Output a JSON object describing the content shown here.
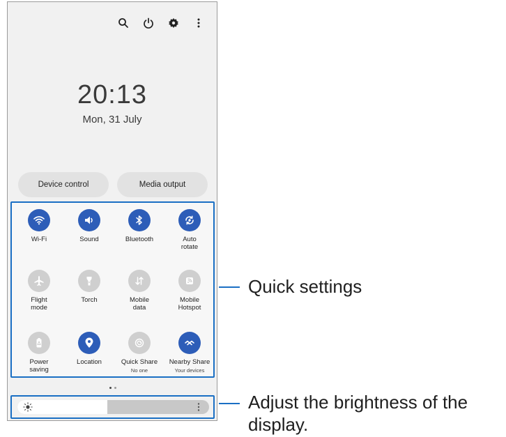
{
  "clock": {
    "time": "20:13",
    "date": "Mon, 31 July"
  },
  "topbar": {
    "icons": [
      "search-icon",
      "power-icon",
      "gear-icon",
      "more-vertical-icon"
    ]
  },
  "pills": {
    "device_control": "Device control",
    "media_output": "Media output"
  },
  "tiles": [
    {
      "label": "Wi-Fi",
      "icon": "wifi-icon",
      "state": "on"
    },
    {
      "label": "Sound",
      "icon": "sound-icon",
      "state": "on"
    },
    {
      "label": "Bluetooth",
      "icon": "bluetooth-icon",
      "state": "on"
    },
    {
      "label": "Auto rotate",
      "icon": "auto-rotate-icon",
      "state": "on"
    },
    {
      "label": "Flight mode",
      "icon": "airplane-icon",
      "state": "off"
    },
    {
      "label": "Torch",
      "icon": "torch-icon",
      "state": "off"
    },
    {
      "label": "Mobile data",
      "icon": "mobile-data-icon",
      "state": "off"
    },
    {
      "label": "Mobile Hotspot",
      "icon": "hotspot-icon",
      "state": "off"
    },
    {
      "label": "Power saving",
      "icon": "battery-icon",
      "state": "off"
    },
    {
      "label": "Location",
      "icon": "location-pin-icon",
      "state": "on"
    },
    {
      "label": "Quick Share",
      "sublabel": "No one",
      "icon": "quick-share-icon",
      "state": "off"
    },
    {
      "label": "Nearby Share",
      "sublabel": "Your devices",
      "icon": "nearby-share-icon",
      "state": "on"
    }
  ],
  "brightness": {
    "level": 0.47
  },
  "callouts": {
    "quick_settings": "Quick settings",
    "brightness_line1": "Adjust the brightness of the",
    "brightness_line2": "display."
  },
  "colors": {
    "accent": "#2d5db8",
    "highlight": "#1a6fc4",
    "tile_off": "#cfcfcf"
  }
}
